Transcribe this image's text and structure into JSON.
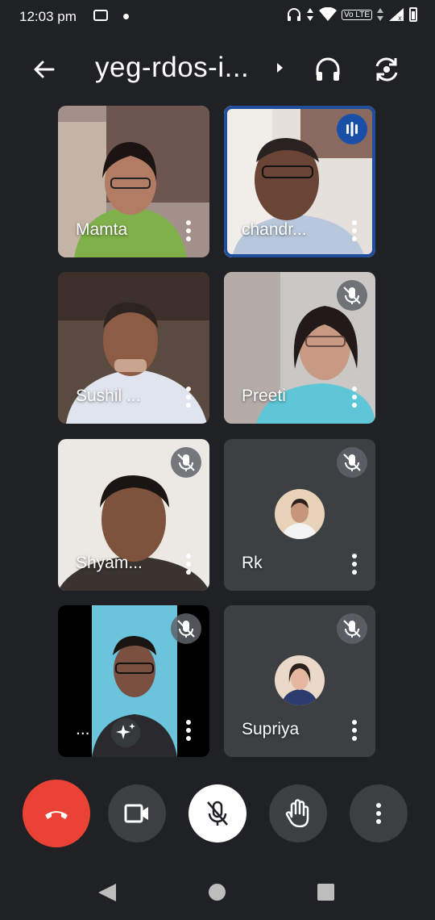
{
  "status_bar": {
    "time": "12:03 pm",
    "volte": "Vo LTE"
  },
  "meeting": {
    "title": "yeg-rdos-i..."
  },
  "participants": [
    {
      "name": "Mamta",
      "muted": false,
      "speaking": false
    },
    {
      "name": "chandr...",
      "muted": false,
      "speaking": true
    },
    {
      "name": "Sushil ...",
      "muted": false,
      "speaking": false
    },
    {
      "name": "Preeti",
      "muted": true,
      "speaking": false
    },
    {
      "name": "Shyam...",
      "muted": true,
      "speaking": false
    },
    {
      "name": "Rk",
      "muted": true,
      "speaking": false
    },
    {
      "name": "...",
      "muted": true,
      "speaking": false
    },
    {
      "name": "Supriya",
      "muted": true,
      "speaking": false
    }
  ],
  "controls": {
    "hangup": "hang-up-icon",
    "camera": "video-camera-icon",
    "mic": "mic-off-icon",
    "hand": "raise-hand-icon",
    "more": "more-vert-icon"
  },
  "colors": {
    "background": "#202124",
    "hangup": "#ea4335",
    "speaking_border": "#1f4e9c"
  }
}
